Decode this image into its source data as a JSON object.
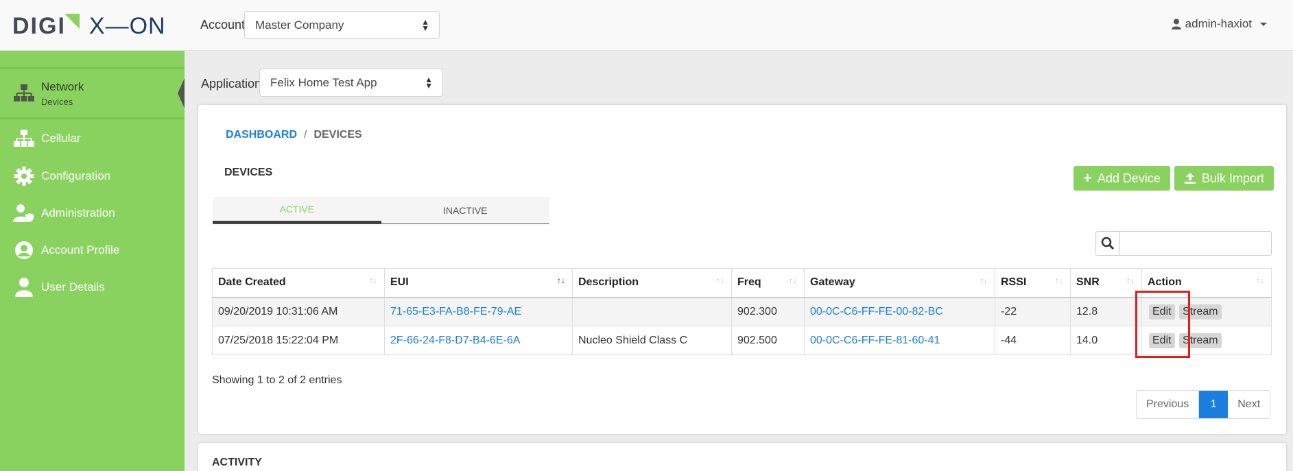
{
  "header": {
    "logo_left": "DIGI",
    "logo_right": "X—ON",
    "account_label": "Account",
    "account_value": "Master Company",
    "user_name": "admin-haxiot"
  },
  "sidebar": {
    "items": [
      {
        "label": "Network",
        "sub": "Devices",
        "icon": "network-icon"
      },
      {
        "label": "Cellular",
        "icon": "network-icon"
      },
      {
        "label": "Configuration",
        "icon": "gear-icon"
      },
      {
        "label": "Administration",
        "icon": "user-shield-icon"
      },
      {
        "label": "Account Profile",
        "icon": "user-circle-icon"
      },
      {
        "label": "User Details",
        "icon": "user-icon"
      }
    ]
  },
  "application": {
    "label": "Application",
    "value": "Felix Home Test App"
  },
  "breadcrumb": {
    "root": "DASHBOARD",
    "sep": "/",
    "current": "DEVICES"
  },
  "devices": {
    "title": "DEVICES",
    "add_button": "Add Device",
    "import_button": "Bulk Import",
    "tabs": [
      "ACTIVE",
      "INACTIVE"
    ],
    "columns": [
      "Date Created",
      "EUI",
      "Description",
      "Freq",
      "Gateway",
      "RSSI",
      "SNR",
      "Action"
    ],
    "rows": [
      {
        "date": "09/20/2019 10:31:06 AM",
        "eui": "71-65-E3-FA-B8-FE-79-AE",
        "description": "",
        "freq": "902.300",
        "gateway": "00-0C-C6-FF-FE-00-82-BC",
        "rssi": "-22",
        "snr": "12.8",
        "edit": "Edit",
        "stream": "Stream"
      },
      {
        "date": "07/25/2018 15:22:04 PM",
        "eui": "2F-66-24-F8-D7-B4-6E-6A",
        "description": "Nucleo Shield Class C",
        "freq": "902.500",
        "gateway": "00-0C-C6-FF-FE-81-60-41",
        "rssi": "-44",
        "snr": "14.0",
        "edit": "Edit",
        "stream": "Stream"
      }
    ],
    "showing": "Showing 1 to 2 of 2 entries",
    "pager": {
      "prev": "Previous",
      "page": "1",
      "next": "Next"
    }
  },
  "activity": {
    "title": "ACTIVITY"
  },
  "colors": {
    "accent": "#8ad25f",
    "link": "#1a7fe0",
    "highlight": "#e01e1e"
  }
}
